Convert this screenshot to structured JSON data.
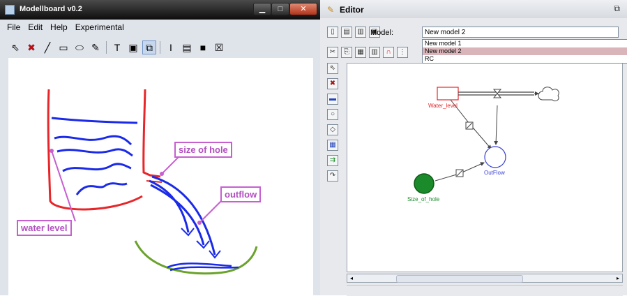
{
  "left_window": {
    "title": "Modellboard v0.2",
    "menu": [
      "File",
      "Edit",
      "Help",
      "Experimental"
    ],
    "toolbar": [
      {
        "name": "select-tool-icon",
        "glyph": "⇖"
      },
      {
        "name": "delete-tool-icon",
        "glyph": "✖"
      },
      {
        "name": "line-tool-icon",
        "glyph": "╱"
      },
      {
        "name": "rectangle-tool-icon",
        "glyph": "▭"
      },
      {
        "name": "ellipse-tool-icon",
        "glyph": "⬭"
      },
      {
        "name": "pen-tool-icon",
        "glyph": "✎"
      },
      {
        "name": "text-tool-icon",
        "glyph": "T"
      },
      {
        "name": "label-tool-icon",
        "glyph": "▣"
      },
      {
        "name": "connect-tool-icon",
        "glyph": "⧉"
      },
      {
        "name": "text-cursor-tool-icon",
        "glyph": "I"
      },
      {
        "name": "thin-stroke-icon",
        "glyph": "▤"
      },
      {
        "name": "thick-stroke-icon",
        "glyph": "■"
      },
      {
        "name": "no-fill-icon",
        "glyph": "☒"
      }
    ],
    "annotations": {
      "size_of_hole": "size of hole",
      "outflow": "outflow",
      "water_level": "water level"
    }
  },
  "right_window": {
    "title": "Editor",
    "model_label": "Model:",
    "model_value": "New model 2",
    "model_options": [
      "New model 1",
      "New model 2",
      "RC"
    ],
    "nodes": {
      "water_level": "Water_level",
      "outflow": "OutFlow",
      "size_of_hole": "Size_of_hole"
    }
  },
  "colors": {
    "stock": "#e8262a",
    "flow_aux": "#3a3fd1",
    "constant": "#1a8a2a",
    "annotation": "#c75fd0",
    "sketch_blue": "#1a2ae8",
    "sketch_red": "#e8262a",
    "sketch_green": "#6aa22a"
  }
}
